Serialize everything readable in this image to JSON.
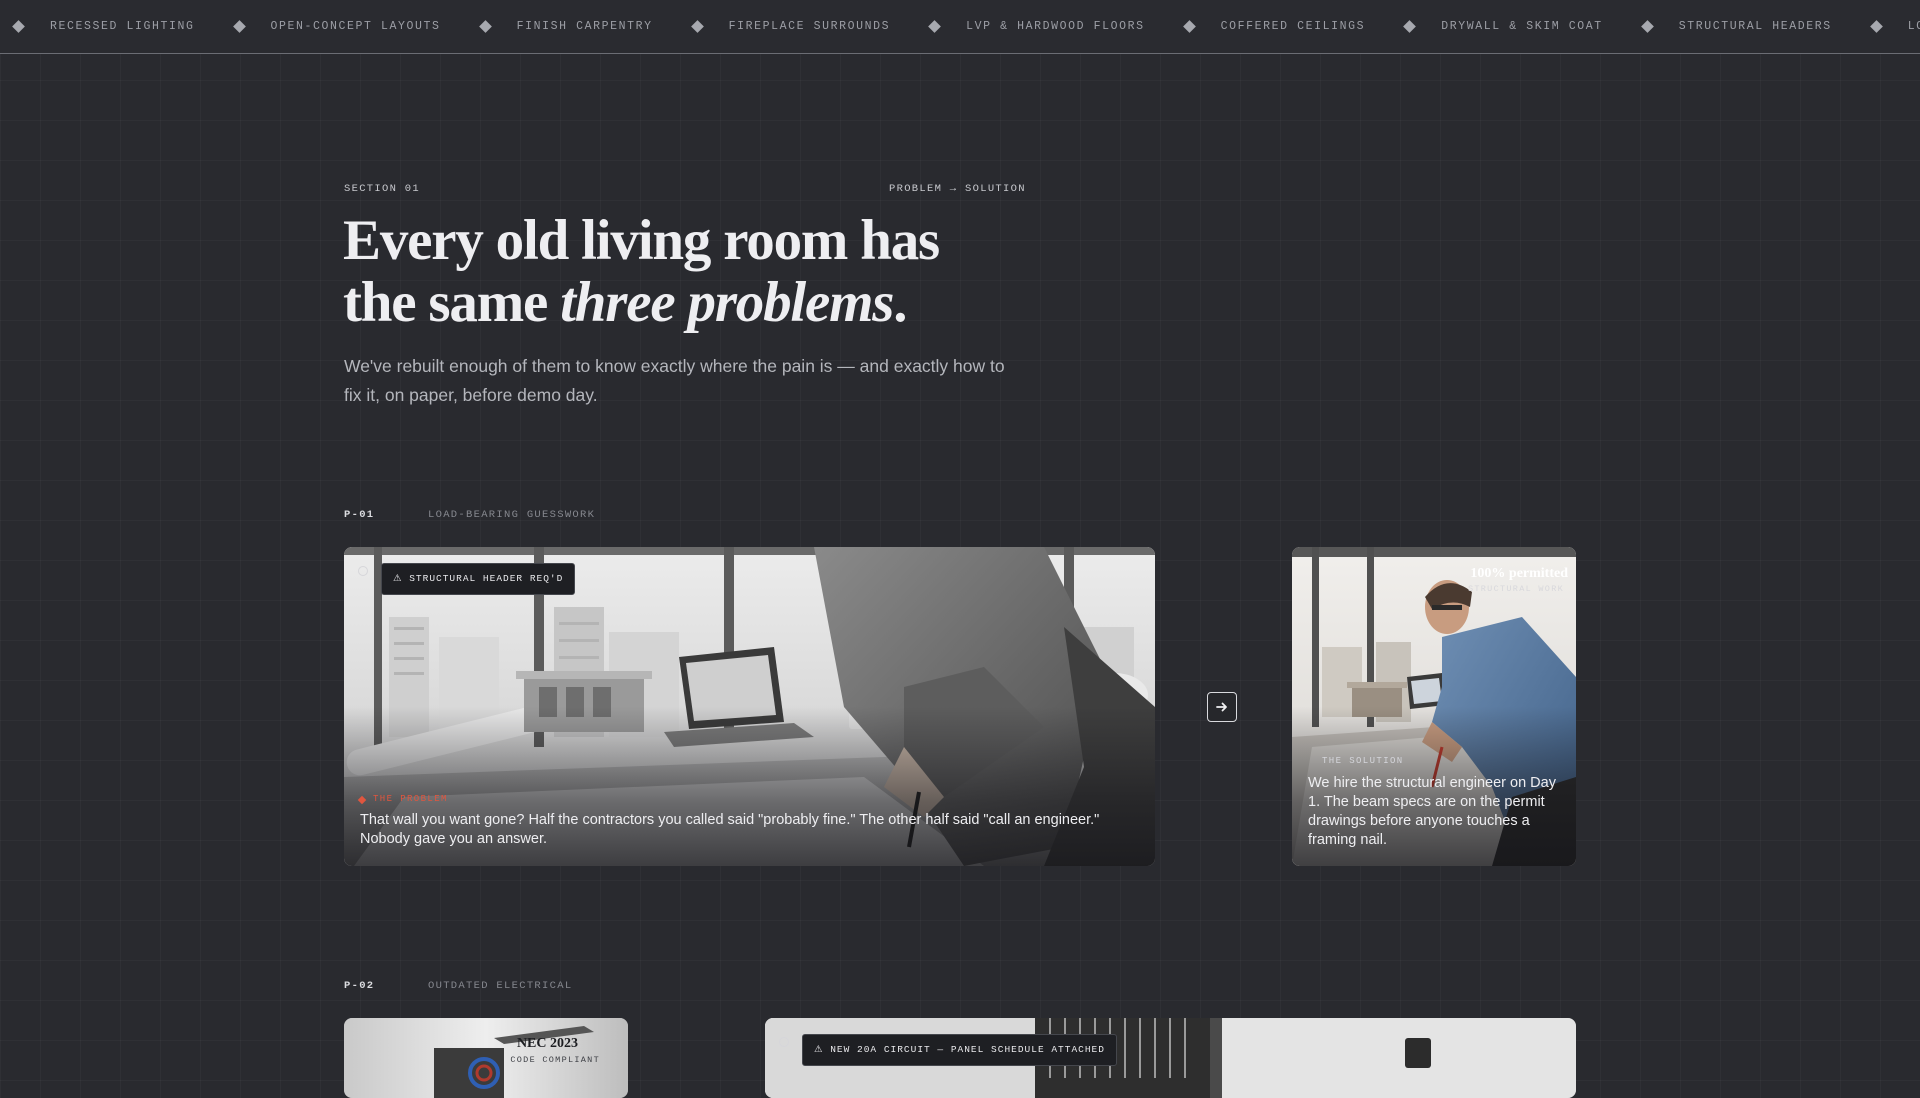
{
  "ticker": {
    "items": [
      {
        "label": "RECESSED LIGHTING",
        "icon": "diamond-icon"
      },
      {
        "label": "OPEN-CONCEPT LAYOUTS",
        "icon": "diamond-icon"
      },
      {
        "label": "FINISH CARPENTRY",
        "icon": "diamond-icon"
      },
      {
        "label": "FIREPLACE SURROUNDS",
        "icon": "diamond-icon"
      },
      {
        "label": "LVP & HARDWOOD FLOORS",
        "icon": "diamond-icon"
      },
      {
        "label": "COFFERED CEILINGS",
        "icon": "diamond-icon"
      },
      {
        "label": "DRYWALL & SKIM COAT",
        "icon": "diamond-icon"
      },
      {
        "label": "STRUCTURAL HEADERS",
        "icon": "diamond-icon"
      },
      {
        "label": "LOAD-BEARING WALL",
        "icon": "diamond-icon"
      }
    ]
  },
  "section": {
    "label": "SECTION 01",
    "tag": "PROBLEM → SOLUTION",
    "headline_line1": "Every old living room has",
    "headline_line2_start": "the same ",
    "headline_emphasis": "three problems",
    "headline_end": ".",
    "subhead": "We've rebuilt enough of them to know exactly where the pain is — and exactly how to fix it, on paper, before demo day."
  },
  "problems": [
    {
      "code": "P-01",
      "title": "LOAD-BEARING GUESSWORK",
      "problem_card": {
        "badge": "⚠ STRUCTURAL HEADER REQ'D",
        "kicker": "THE PROBLEM",
        "text": "That wall you want gone? Half the contractors you called said \"probably fine.\" The other half said \"call an engineer.\" Nobody gave you an answer."
      },
      "arrow_icon": "arrow-right-icon",
      "solution_card": {
        "stat_value": "100% permitted",
        "stat_label": "STRUCTURAL WORK",
        "kicker": "THE SOLUTION",
        "text": "We hire the structural engineer on Day 1. The beam specs are on the permit drawings before anyone touches a framing nail."
      }
    },
    {
      "code": "P-02",
      "title": "OUTDATED ELECTRICAL",
      "solution_card": {
        "stat_value": "NEC 2023",
        "stat_label": "CODE COMPLIANT"
      },
      "problem_card": {
        "badge": "⚠ NEW 20A CIRCUIT — PANEL SCHEDULE ATTACHED"
      }
    }
  ],
  "colors": {
    "background": "#292a2f",
    "accent_red": "#e0563f",
    "text_primary": "#eeeef1",
    "text_muted": "#86888f"
  }
}
